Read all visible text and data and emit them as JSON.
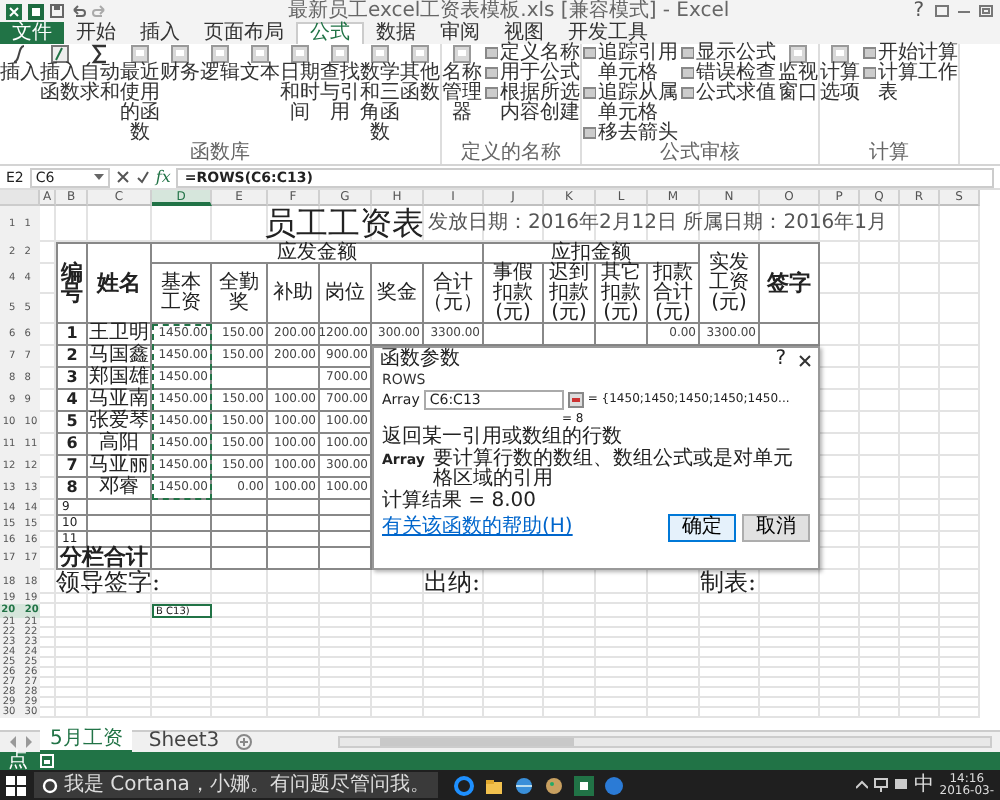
{
  "window": {
    "title": "最新员工excel工资表模板.xls [兼容模式] - Excel",
    "help": "?"
  },
  "ribbon": {
    "tabs": [
      {
        "label": "文件",
        "selected": false,
        "kind": "file"
      },
      {
        "label": "开始",
        "selected": false,
        "kind": "tab"
      },
      {
        "label": "插入",
        "selected": false,
        "kind": "tab"
      },
      {
        "label": "页面布局",
        "selected": false,
        "kind": "tab"
      },
      {
        "label": "公式",
        "selected": true,
        "kind": "tab"
      },
      {
        "label": "数据",
        "selected": false,
        "kind": "tab"
      },
      {
        "label": "审阅",
        "selected": false,
        "kind": "tab"
      },
      {
        "label": "视图",
        "selected": false,
        "kind": "tab"
      },
      {
        "label": "开发工具",
        "selected": false,
        "kind": "tab"
      }
    ],
    "groups": [
      {
        "title": "函数库",
        "columns": [
          [
            {
              "label": "插入",
              "kind": "large"
            }
          ],
          [
            {
              "label": "插入函数",
              "kind": "large"
            }
          ],
          [
            {
              "label": "自动求和",
              "kind": "large"
            }
          ],
          [
            {
              "label": "最近使用的函数",
              "kind": "large"
            }
          ],
          [
            {
              "label": "财务",
              "kind": "large"
            }
          ],
          [
            {
              "label": "逻辑",
              "kind": "large"
            }
          ],
          [
            {
              "label": "文本",
              "kind": "large"
            }
          ],
          [
            {
              "label": "日期和时间",
              "kind": "large"
            }
          ],
          [
            {
              "label": "查找与引用",
              "kind": "large"
            }
          ],
          [
            {
              "label": "数学和三角函数",
              "kind": "large"
            }
          ],
          [
            {
              "label": "其他函数",
              "kind": "large"
            }
          ]
        ]
      },
      {
        "title": "定义的名称",
        "columns": [
          [
            {
              "label": "名称管理器",
              "kind": "large"
            }
          ],
          [
            {
              "label": "定义名称",
              "kind": "small"
            },
            {
              "label": "用于公式",
              "kind": "small"
            },
            {
              "label": "根据所选内容创建",
              "kind": "small"
            }
          ]
        ]
      },
      {
        "title": "公式审核",
        "columns": [
          [
            {
              "label": "追踪引用单元格",
              "kind": "small"
            },
            {
              "label": "追踪从属单元格",
              "kind": "small"
            },
            {
              "label": "移去箭头",
              "kind": "small"
            }
          ],
          [
            {
              "label": "显示公式",
              "kind": "small"
            },
            {
              "label": "错误检查",
              "kind": "small"
            },
            {
              "label": "公式求值",
              "kind": "small"
            }
          ],
          [
            {
              "label": "监视窗口",
              "kind": "large"
            }
          ]
        ]
      },
      {
        "title": "计算",
        "columns": [
          [
            {
              "label": "计算选项",
              "kind": "large"
            }
          ],
          [
            {
              "label": "开始计算",
              "kind": "small"
            },
            {
              "label": "计算工作表",
              "kind": "small"
            }
          ]
        ]
      }
    ]
  },
  "formula_bar": {
    "cell_ref": "E2",
    "name_box": "C6",
    "fx": "fx",
    "formula": "=ROWS(C6:C13)"
  },
  "sheet": {
    "columns": [
      {
        "label": "A",
        "selected": false
      },
      {
        "label": "B",
        "selected": false
      },
      {
        "label": "C",
        "selected": false
      },
      {
        "label": "D",
        "selected": true
      },
      {
        "label": "E",
        "selected": false
      },
      {
        "label": "F",
        "selected": false
      },
      {
        "label": "G",
        "selected": false
      },
      {
        "label": "H",
        "selected": false
      },
      {
        "label": "I",
        "selected": false
      },
      {
        "label": "J",
        "selected": false
      },
      {
        "label": "K",
        "selected": false
      },
      {
        "label": "L",
        "selected": false
      },
      {
        "label": "M",
        "selected": false
      },
      {
        "label": "N",
        "selected": false
      },
      {
        "label": "O",
        "selected": false
      },
      {
        "label": "P",
        "selected": false
      },
      {
        "label": "Q",
        "selected": false
      },
      {
        "label": "R",
        "selected": false
      },
      {
        "label": "S",
        "selected": false
      }
    ],
    "copy_marquee": true,
    "rows": [
      {
        "header": "1 1",
        "kind": "title",
        "selected": false,
        "cells": {
          "D": {
            "text": "员工工资表",
            "kind": "title"
          },
          "I": {
            "text": "发放日期：2016年2月12日 所属日期：2016年1月",
            "kind": "note"
          }
        }
      },
      {
        "header": "2 2",
        "kind": "head",
        "selected": false,
        "cells": {
          "B": {
            "text": "编号",
            "kind": "big"
          },
          "C": {
            "text": "姓名",
            "kind": "big"
          },
          "D": {
            "text": "应发金额",
            "kind": "head"
          },
          "J": {
            "text": "应扣金额",
            "kind": "head"
          },
          "N": {
            "text": "实发工资(元)",
            "kind": "head"
          },
          "O": {
            "text": "签字",
            "kind": "big"
          }
        }
      },
      {
        "header": "4 4",
        "kind": "sub",
        "selected": false,
        "cells": {
          "D": {
            "text": "基本工资",
            "kind": "head"
          },
          "E": {
            "text": "全勤奖",
            "kind": "head"
          },
          "F": {
            "text": "补助",
            "kind": "head"
          },
          "G": {
            "text": "岗位",
            "kind": "head"
          },
          "H": {
            "text": "奖金",
            "kind": "head"
          },
          "I": {
            "text": "合计（元）",
            "kind": "head"
          },
          "J": {
            "text": "事假扣款(元)",
            "kind": "head"
          },
          "K": {
            "text": "迟到扣款(元)",
            "kind": "head"
          },
          "L": {
            "text": "其它扣款(元)",
            "kind": "head"
          },
          "M": {
            "text": "扣款合计(元)",
            "kind": "head"
          }
        }
      },
      {
        "header": "5 5",
        "kind": "sub",
        "selected": false,
        "cells": {}
      },
      {
        "header": "6 6",
        "kind": "data",
        "selected": false,
        "cells": {
          "B": {
            "text": "1",
            "kind": "id"
          },
          "C": {
            "text": "王卫明",
            "kind": "name"
          },
          "D": {
            "text": "1450.00",
            "kind": "num"
          },
          "E": {
            "text": "150.00",
            "kind": "num"
          },
          "F": {
            "text": "200.00",
            "kind": "num"
          },
          "G": {
            "text": "1200.00",
            "kind": "num"
          },
          "H": {
            "text": "300.00",
            "kind": "num"
          },
          "I": {
            "text": "3300.00",
            "kind": "num"
          },
          "M": {
            "text": "0.00",
            "kind": "num"
          },
          "N": {
            "text": "3300.00",
            "kind": "num"
          }
        }
      },
      {
        "header": "7 7",
        "kind": "data",
        "selected": false,
        "cells": {
          "B": {
            "text": "2",
            "kind": "id"
          },
          "C": {
            "text": "马国鑫",
            "kind": "name"
          },
          "D": {
            "text": "1450.00",
            "kind": "num"
          },
          "E": {
            "text": "150.00",
            "kind": "num"
          },
          "F": {
            "text": "200.00",
            "kind": "num"
          },
          "G": {
            "text": "900.00",
            "kind": "num"
          }
        }
      },
      {
        "header": "8 8",
        "kind": "data",
        "selected": false,
        "cells": {
          "B": {
            "text": "3",
            "kind": "id"
          },
          "C": {
            "text": "郑国雄",
            "kind": "name"
          },
          "D": {
            "text": "1450.00",
            "kind": "num"
          },
          "G": {
            "text": "700.00",
            "kind": "num"
          }
        }
      },
      {
        "header": "9 9",
        "kind": "data",
        "selected": false,
        "cells": {
          "B": {
            "text": "4",
            "kind": "id"
          },
          "C": {
            "text": "马亚南",
            "kind": "name"
          },
          "D": {
            "text": "1450.00",
            "kind": "num"
          },
          "E": {
            "text": "150.00",
            "kind": "num"
          },
          "F": {
            "text": "100.00",
            "kind": "num"
          },
          "G": {
            "text": "700.00",
            "kind": "num"
          }
        }
      },
      {
        "header": "10 10",
        "kind": "data",
        "selected": false,
        "cells": {
          "B": {
            "text": "5",
            "kind": "id"
          },
          "C": {
            "text": "张爱琴",
            "kind": "name"
          },
          "D": {
            "text": "1450.00",
            "kind": "num"
          },
          "E": {
            "text": "150.00",
            "kind": "num"
          },
          "F": {
            "text": "100.00",
            "kind": "num"
          },
          "G": {
            "text": "100.00",
            "kind": "num"
          }
        }
      },
      {
        "header": "11 11",
        "kind": "data",
        "selected": false,
        "cells": {
          "B": {
            "text": "6",
            "kind": "id"
          },
          "C": {
            "text": "高阳",
            "kind": "name"
          },
          "D": {
            "text": "1450.00",
            "kind": "num"
          },
          "E": {
            "text": "150.00",
            "kind": "num"
          },
          "F": {
            "text": "100.00",
            "kind": "num"
          },
          "G": {
            "text": "100.00",
            "kind": "num"
          }
        }
      },
      {
        "header": "12 12",
        "kind": "data",
        "selected": false,
        "cells": {
          "B": {
            "text": "7",
            "kind": "id"
          },
          "C": {
            "text": "马亚丽",
            "kind": "name"
          },
          "D": {
            "text": "1450.00",
            "kind": "num"
          },
          "E": {
            "text": "150.00",
            "kind": "num"
          },
          "F": {
            "text": "100.00",
            "kind": "num"
          },
          "G": {
            "text": "300.00",
            "kind": "num"
          }
        }
      },
      {
        "header": "13 13",
        "kind": "data",
        "selected": false,
        "cells": {
          "B": {
            "text": "8",
            "kind": "id"
          },
          "C": {
            "text": "邓睿",
            "kind": "name"
          },
          "D": {
            "text": "1450.00",
            "kind": "num"
          },
          "E": {
            "text": "0.00",
            "kind": "num"
          },
          "F": {
            "text": "100.00",
            "kind": "num"
          },
          "G": {
            "text": "100.00",
            "kind": "num"
          }
        }
      },
      {
        "header": "14 14",
        "kind": "short",
        "selected": false,
        "cells": {
          "B": {
            "text": "9",
            "kind": "small"
          }
        }
      },
      {
        "header": "15 15",
        "kind": "short",
        "selected": false,
        "cells": {
          "B": {
            "text": "10",
            "kind": "small"
          }
        }
      },
      {
        "header": "16 16",
        "kind": "short",
        "selected": false,
        "cells": {
          "B": {
            "text": "11",
            "kind": "small"
          }
        }
      },
      {
        "header": "17 17",
        "kind": "total",
        "selected": false,
        "cells": {
          "B": {
            "text": "分栏合计",
            "kind": "total"
          }
        }
      },
      {
        "header": "18 18",
        "kind": "sign",
        "selected": false,
        "cells": {
          "B": {
            "text": "领导签字:",
            "kind": "sign"
          },
          "I": {
            "text": "出纳:",
            "kind": "sign"
          },
          "N": {
            "text": "制表:",
            "kind": "sign"
          }
        }
      },
      {
        "header": "19 19",
        "kind": "blank",
        "selected": false,
        "cells": {}
      },
      {
        "header": "20 20",
        "kind": "edit",
        "selected": true,
        "cells": {
          "D": {
            "text": "B C13)",
            "kind": "edit"
          }
        }
      },
      {
        "header": "21 21",
        "kind": "blank",
        "selected": false,
        "cells": {}
      },
      {
        "header": "22 22",
        "kind": "blank",
        "selected": false,
        "cells": {}
      },
      {
        "header": "23 23",
        "kind": "blank",
        "selected": false,
        "cells": {}
      },
      {
        "header": "24 24",
        "kind": "blank",
        "selected": false,
        "cells": {}
      },
      {
        "header": "25 25",
        "kind": "blank",
        "selected": false,
        "cells": {}
      },
      {
        "header": "26 26",
        "kind": "blank",
        "selected": false,
        "cells": {}
      },
      {
        "header": "27 27",
        "kind": "blank",
        "selected": false,
        "cells": {}
      },
      {
        "header": "28 28",
        "kind": "blank",
        "selected": false,
        "cells": {}
      },
      {
        "header": "29 29",
        "kind": "blank",
        "selected": false,
        "cells": {}
      },
      {
        "header": "30 30",
        "kind": "blank",
        "selected": false,
        "cells": {}
      }
    ]
  },
  "dialog": {
    "title": "函数参数",
    "help": "?",
    "function": "ROWS",
    "argument": {
      "label": "Array",
      "value": "C6:C13",
      "preview": "= {1450;1450;1450;1450;1450..."
    },
    "result_preview": "= 8",
    "description": "返回某一引用或数组的行数",
    "argument_help": {
      "label": "Array",
      "text": "要计算行数的数组、数组公式或是对单元格区域的引用"
    },
    "result": "计算结果 =  8.00",
    "help_link": "有关该函数的帮助(H)",
    "buttons": [
      {
        "label": "确定",
        "selected": true
      },
      {
        "label": "取消",
        "selected": false
      }
    ]
  },
  "sheet_tabs": [
    {
      "label": "5月工资",
      "selected": true
    },
    {
      "label": "Sheet3",
      "selected": false
    }
  ],
  "status_bar": {
    "mode": "点"
  },
  "taskbar": {
    "search": "我是 Cortana，小娜。有问题尽管问我。",
    "ime": "中",
    "time": "14:16",
    "date": "2016-03-"
  }
}
